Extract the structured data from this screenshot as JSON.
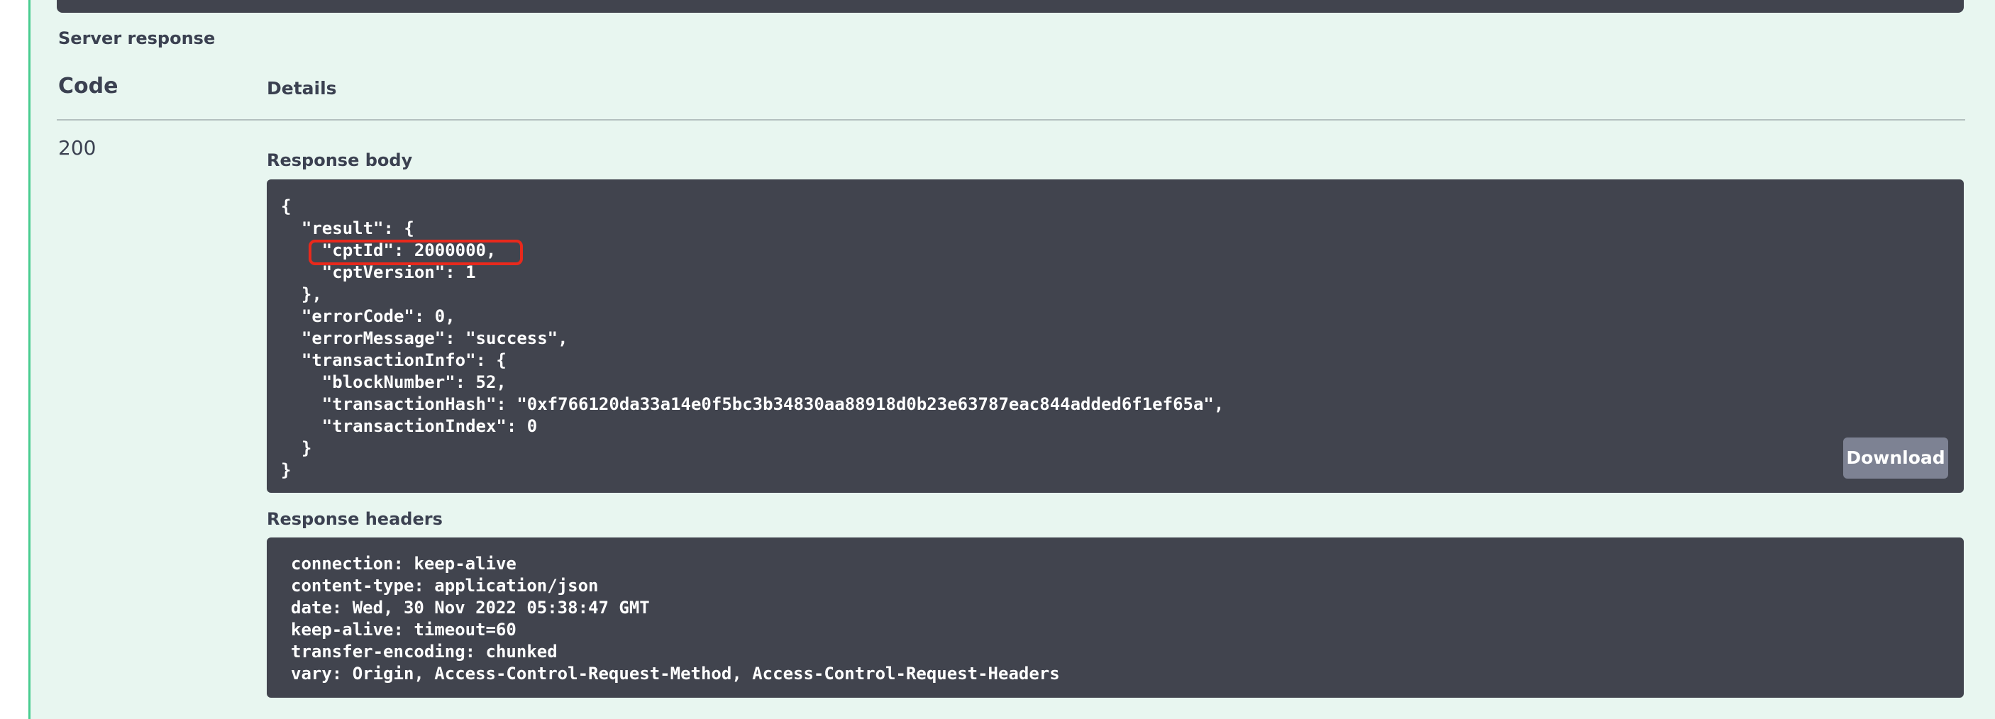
{
  "server_response": {
    "label": "Server response",
    "code_header": "Code",
    "details_header": "Details",
    "code": "200",
    "response_body": {
      "label": "Response body",
      "json_text": "{\n  \"result\": {\n    \"cptId\": 2000000,\n    \"cptVersion\": 1\n  },\n  \"errorCode\": 0,\n  \"errorMessage\": \"success\",\n  \"transactionInfo\": {\n    \"blockNumber\": 52,\n    \"transactionHash\": \"0xf766120da33a14e0f5bc3b34830aa88918d0b23e63787eac844added6f1ef65a\",\n    \"transactionIndex\": 0\n  }\n}",
      "download_label": "Download"
    },
    "response_headers": {
      "label": "Response headers",
      "text": "connection: keep-alive\ncontent-type: application/json\ndate: Wed, 30 Nov 2022 05:38:47 GMT\nkeep-alive: timeout=60\ntransfer-encoding: chunked\nvary: Origin, Access-Control-Request-Method, Access-Control-Request-Headers"
    }
  },
  "colors": {
    "panel_background": "#e8f6f0",
    "panel_border": "#49cc90",
    "code_block_background": "#41444e",
    "download_button": "#7d8293",
    "highlight": "#e8291c"
  }
}
